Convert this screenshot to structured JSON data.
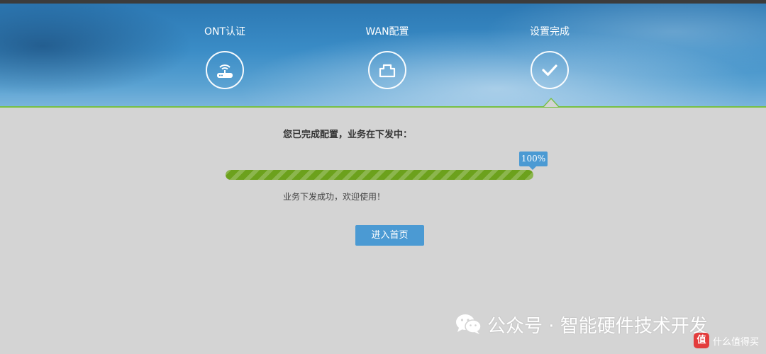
{
  "steps": [
    {
      "label": "ONT认证",
      "icon": "router-icon"
    },
    {
      "label": "WAN配置",
      "icon": "network-port-icon"
    },
    {
      "label": "设置完成",
      "icon": "checkmark-icon"
    }
  ],
  "active_step": 3,
  "main": {
    "title": "您已完成配置，业务在下发中：",
    "progress": {
      "value": 100,
      "label": "100%"
    },
    "status": "业务下发成功，欢迎使用！",
    "enter_button": "进入首页"
  },
  "watermark": {
    "text": "公众号 · 智能硬件技术开发",
    "icon": "wechat-icon"
  },
  "corner_logo": {
    "text": "什么值得买",
    "badge": "值"
  },
  "colors": {
    "accent_blue": "#4b9ad3",
    "progress_green": "#6ca11c",
    "banner_line_green": "#77c043",
    "background": "#d4d4d4"
  }
}
